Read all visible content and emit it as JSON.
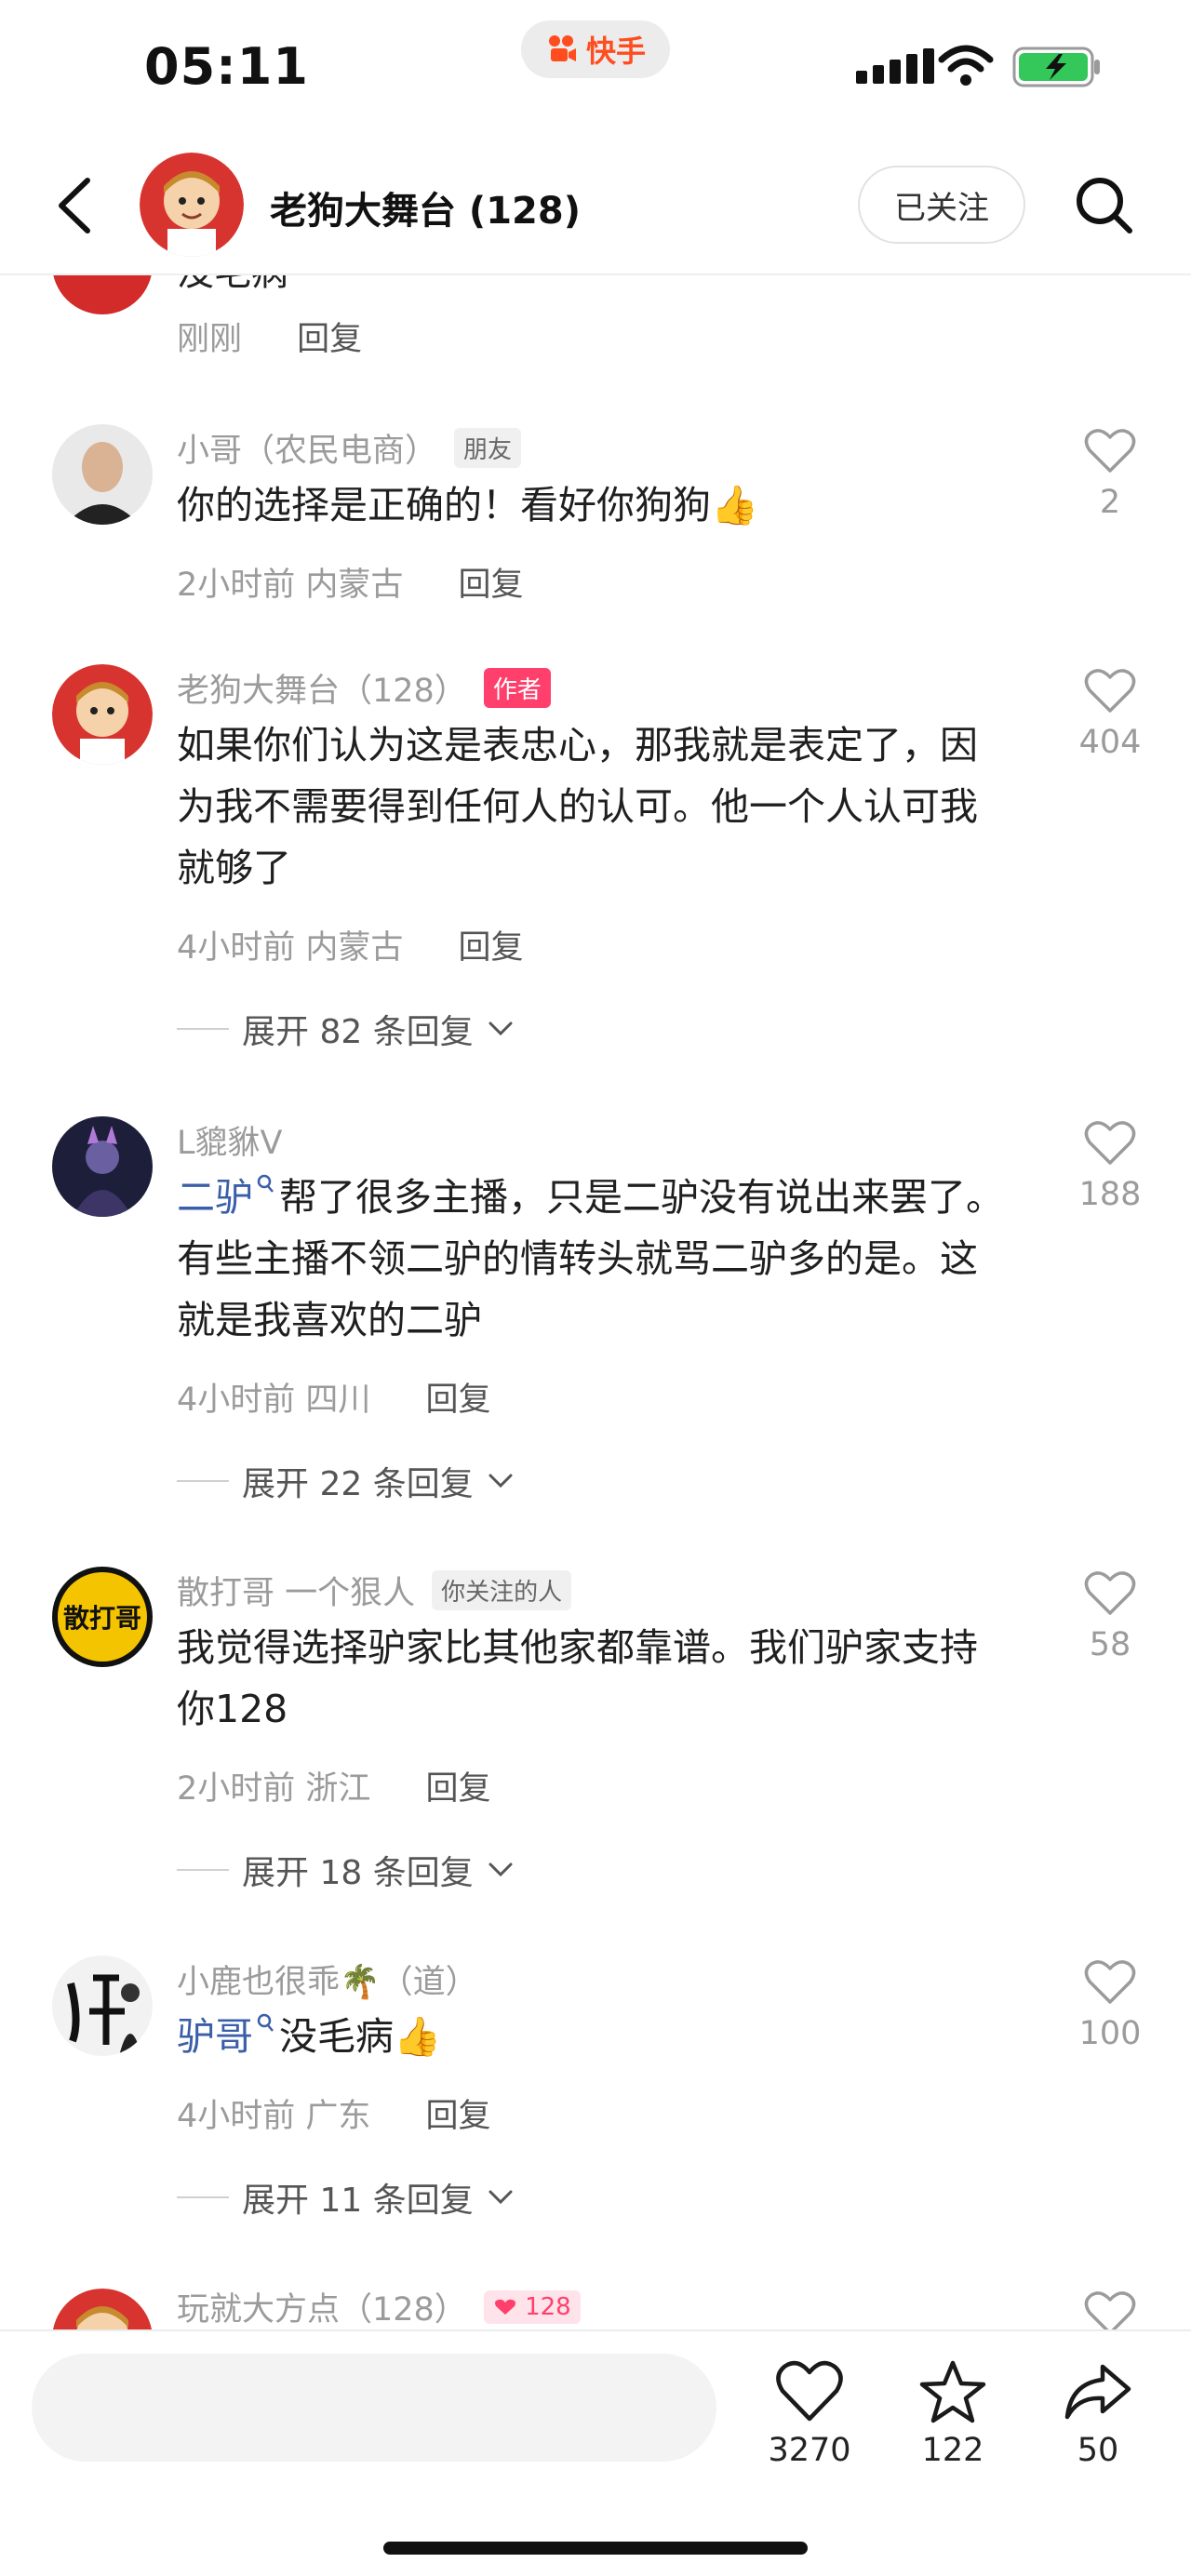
{
  "status_bar": {
    "time": "05:11",
    "app_name": "快手"
  },
  "header": {
    "title": "老狗大舞台 (128)",
    "follow_label": "已关注"
  },
  "partial_comment": {
    "text": "没毛病",
    "time": "刚刚",
    "reply_label": "回复"
  },
  "comments": [
    {
      "author": "小哥（农民电商）",
      "badge": "朋友",
      "text": "你的选择是正确的！看好你狗狗👍",
      "time": "2小时前 内蒙古",
      "reply_label": "回复",
      "likes": "2"
    },
    {
      "author": "老狗大舞台（128）",
      "badge": "作者",
      "text": "如果你们认为这是表忠心，那我就是表定了，因为我不需要得到任何人的认可。他一个人认可我就够了",
      "time": "4小时前 内蒙古",
      "reply_label": "回复",
      "likes": "404",
      "expand_label": "展开 82 条回复"
    },
    {
      "author": "L貔貅V",
      "mention": "二驴",
      "text": "帮了很多主播，只是二驴没有说出来罢了。有些主播不领二驴的情转头就骂二驴多的是。这就是我喜欢的二驴",
      "time": "4小时前 四川",
      "reply_label": "回复",
      "likes": "188",
      "expand_label": "展开 22 条回复"
    },
    {
      "author": "散打哥 一个狠人",
      "badge": "你关注的人",
      "avatar_text": "散打哥",
      "text": "我觉得选择驴家比其他家都靠谱。我们驴家支持你128",
      "time": "2小时前 浙江",
      "reply_label": "回复",
      "likes": "58",
      "expand_label": "展开 18 条回复"
    },
    {
      "author": "小鹿也很乖🌴（道）",
      "mention": "驴哥",
      "text": "没毛病👍",
      "time": "4小时前 广东",
      "reply_label": "回复",
      "likes": "100",
      "expand_label": "展开 11 条回复"
    },
    {
      "author": "玩就大方点（128）",
      "badge": "128"
    }
  ],
  "bottom_bar": {
    "like_count": "3270",
    "favorite_count": "122",
    "share_count": "50"
  },
  "colors": {
    "accent": "#ff3f6c",
    "mention": "#3a5fa8",
    "meta": "#9b9b9b"
  }
}
